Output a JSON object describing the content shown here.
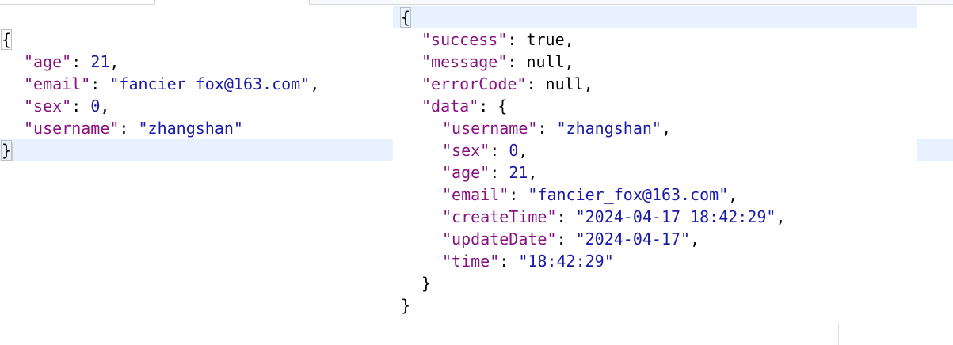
{
  "left_pane": {
    "open_brace": "{",
    "lines": [
      {
        "key": "\"age\"",
        "value": "21",
        "type": "number",
        "trail": ","
      },
      {
        "key": "\"email\"",
        "value": "\"fancier_fox@163.com\"",
        "type": "string",
        "trail": ","
      },
      {
        "key": "\"sex\"",
        "value": "0",
        "type": "number",
        "trail": ","
      },
      {
        "key": "\"username\"",
        "value": "\"zhangshan\"",
        "type": "string",
        "trail": ""
      }
    ],
    "close_brace": "}"
  },
  "right_pane": {
    "open_brace": "{",
    "lines": [
      {
        "key": "\"success\"",
        "value": "true",
        "type": "literal",
        "trail": ","
      },
      {
        "key": "\"message\"",
        "value": "null",
        "type": "literal",
        "trail": ","
      },
      {
        "key": "\"errorCode\"",
        "value": "null",
        "type": "literal",
        "trail": ","
      },
      {
        "key": "\"data\"",
        "value": "{",
        "type": "literal",
        "trail": ""
      }
    ],
    "data_lines": [
      {
        "key": "\"username\"",
        "value": "\"zhangshan\"",
        "type": "string",
        "trail": ","
      },
      {
        "key": "\"sex\"",
        "value": "0",
        "type": "number",
        "trail": ","
      },
      {
        "key": "\"age\"",
        "value": "21",
        "type": "number",
        "trail": ","
      },
      {
        "key": "\"email\"",
        "value": "\"fancier_fox@163.com\"",
        "type": "string",
        "trail": ","
      },
      {
        "key": "\"createTime\"",
        "value": "\"2024-04-17 18:42:29\"",
        "type": "string",
        "trail": ","
      },
      {
        "key": "\"updateDate\"",
        "value": "\"2024-04-17\"",
        "type": "string",
        "trail": ","
      },
      {
        "key": "\"time\"",
        "value": "\"18:42:29\"",
        "type": "string",
        "trail": ""
      }
    ],
    "data_close": "}",
    "close_brace": "}"
  },
  "colors": {
    "key": "#881280",
    "string": "#1a1aa6",
    "number": "#1a1aa6",
    "line_highlight": "#e8f2fe"
  }
}
